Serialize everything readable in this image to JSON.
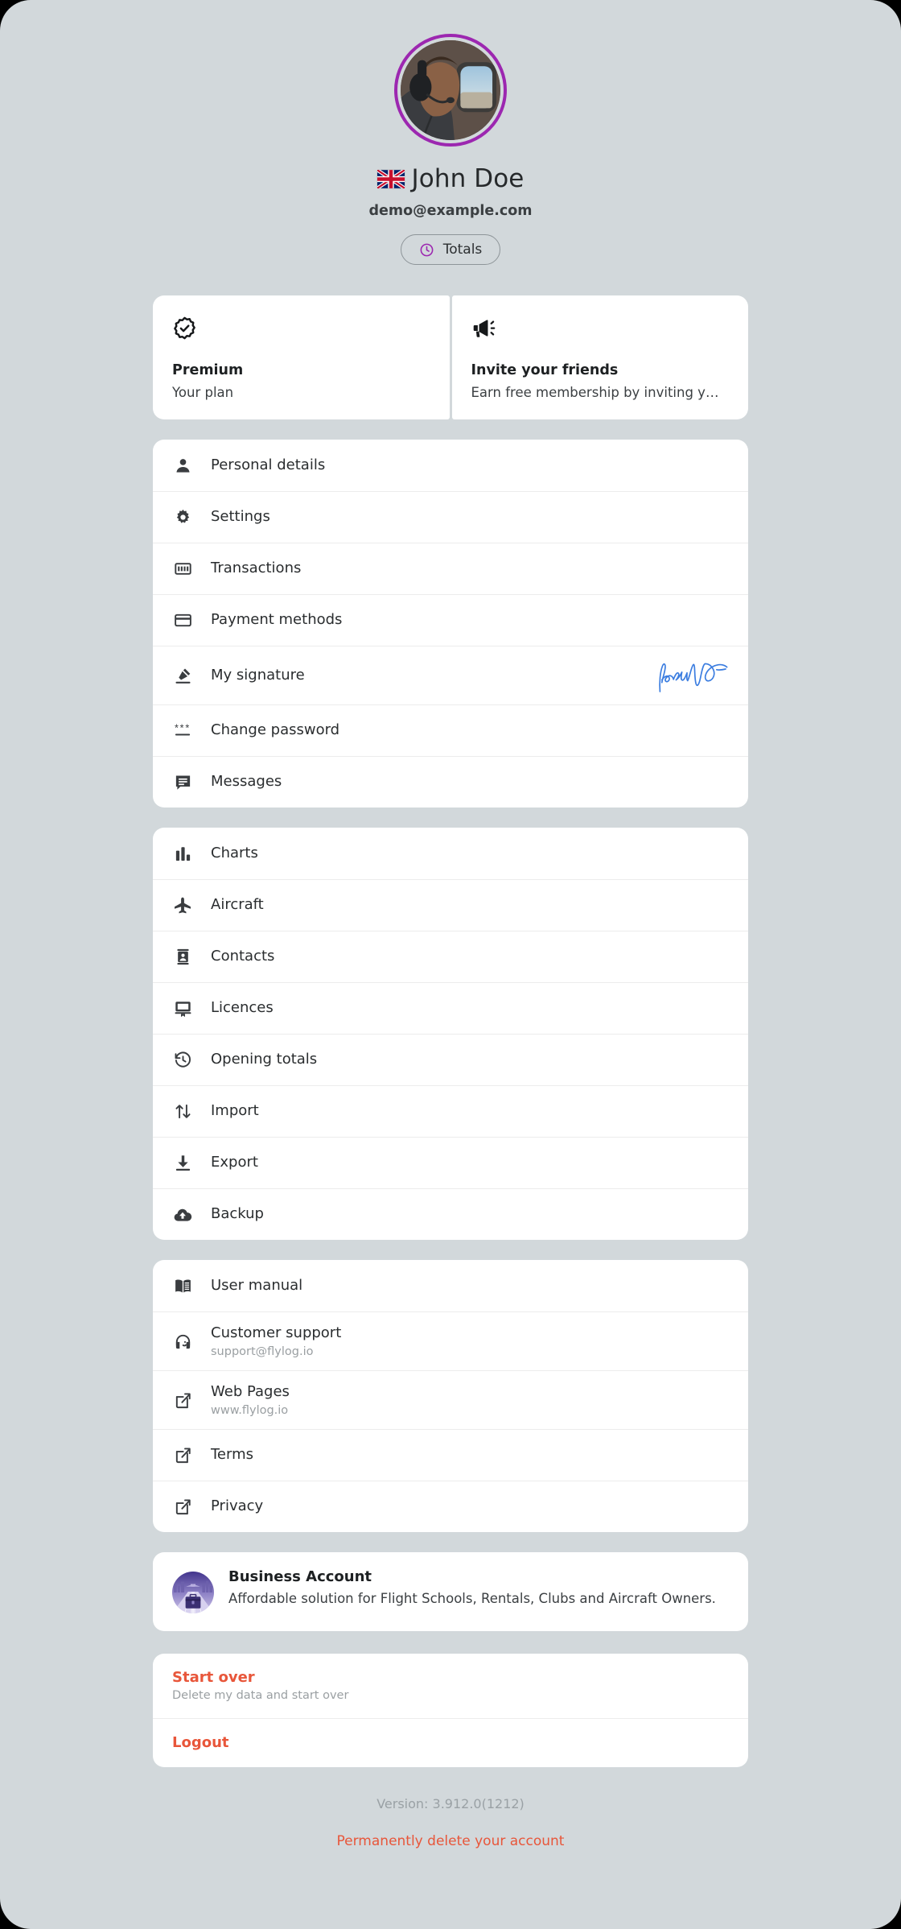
{
  "profile": {
    "name": "John Doe",
    "flag": "uk-flag-icon",
    "email": "demo@example.com",
    "avatar_icon": "pilot-avatar",
    "avatar_ring_color": "#9c27b0",
    "totals_chip": {
      "label": "Totals",
      "icon": "clock-icon",
      "icon_color": "#9c27b0"
    }
  },
  "stats": [
    {
      "icon": "verified-badge-icon",
      "title": "Premium",
      "subtitle": "Your plan"
    },
    {
      "icon": "megaphone-icon",
      "title": "Invite your friends",
      "subtitle": "Earn free membership by inviting y…"
    }
  ],
  "groups": [
    {
      "id": "account",
      "items": [
        {
          "icon": "person-icon",
          "label": "Personal details"
        },
        {
          "icon": "gear-icon",
          "label": "Settings"
        },
        {
          "icon": "banknote-icon",
          "label": "Transactions"
        },
        {
          "icon": "credit-card-icon",
          "label": "Payment methods"
        },
        {
          "icon": "signature-pen-icon",
          "label": "My signature",
          "signature": "John Doe",
          "signature_color": "#3b7de0"
        },
        {
          "icon": "asterisks-icon",
          "label": "Change password"
        },
        {
          "icon": "chat-icon",
          "label": "Messages"
        }
      ]
    },
    {
      "id": "logbook",
      "items": [
        {
          "icon": "bar-chart-icon",
          "label": "Charts"
        },
        {
          "icon": "airplane-icon",
          "label": "Aircraft"
        },
        {
          "icon": "contact-card-icon",
          "label": "Contacts"
        },
        {
          "icon": "licence-icon",
          "label": "Licences"
        },
        {
          "icon": "history-clock-icon",
          "label": "Opening totals"
        },
        {
          "icon": "import-arrows-icon",
          "label": "Import"
        },
        {
          "icon": "download-icon",
          "label": "Export"
        },
        {
          "icon": "cloud-upload-icon",
          "label": "Backup"
        }
      ]
    },
    {
      "id": "help",
      "items": [
        {
          "icon": "book-icon",
          "label": "User manual"
        },
        {
          "icon": "headset-icon",
          "label": "Customer support",
          "sub": "support@flylog.io"
        },
        {
          "icon": "external-link-icon",
          "label": "Web Pages",
          "sub": "www.flylog.io"
        },
        {
          "icon": "external-link-icon",
          "label": "Terms"
        },
        {
          "icon": "external-link-icon",
          "label": "Privacy"
        }
      ]
    }
  ],
  "business": {
    "icon": "briefcase-runway-icon",
    "title": "Business Account",
    "subtitle": "Affordable solution for Flight Schools, Rentals, Clubs and Aircraft Owners."
  },
  "danger": {
    "color": "#e8563a",
    "items": [
      {
        "label": "Start over",
        "sub": "Delete my data and start over"
      },
      {
        "label": "Logout"
      }
    ]
  },
  "footer": {
    "version": "Version: 3.912.0(1212)",
    "delete_account": "Permanently delete your account"
  }
}
